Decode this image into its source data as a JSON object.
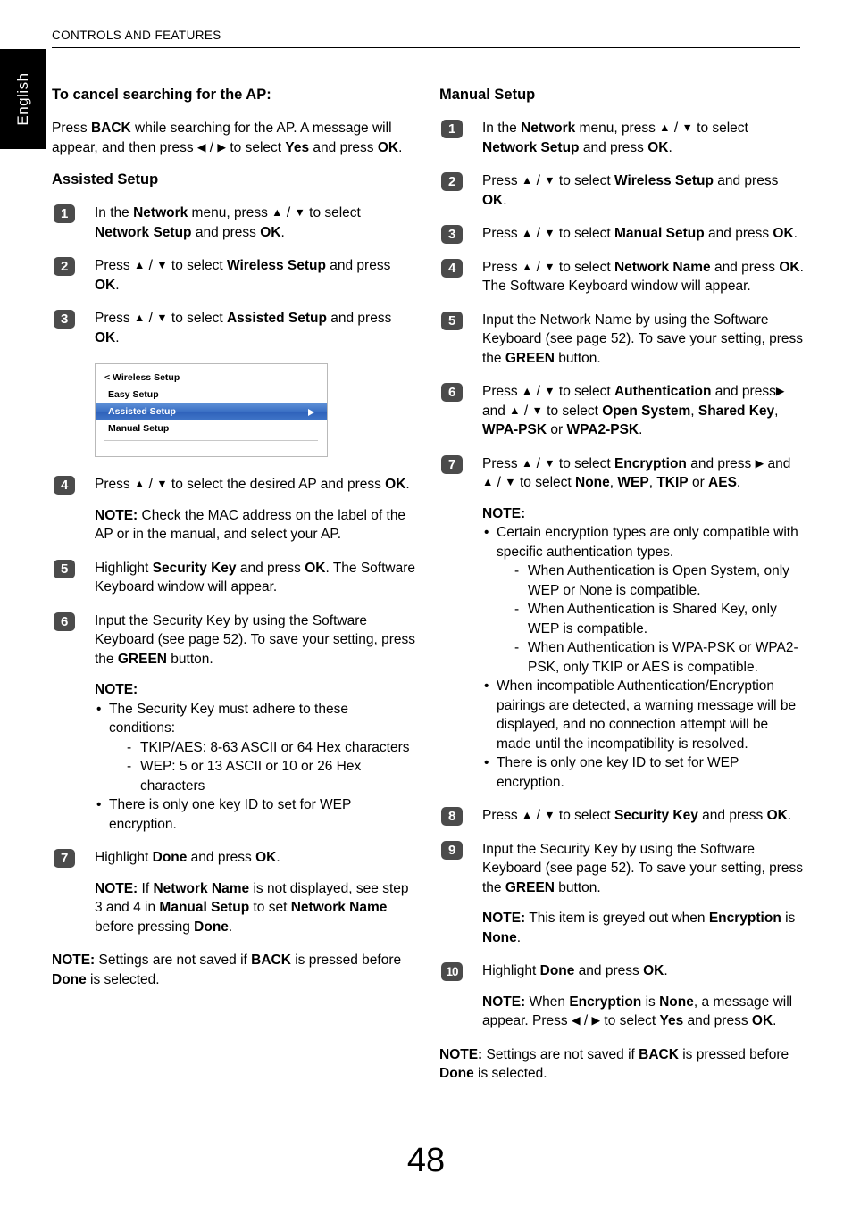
{
  "header": {
    "title": "CONTROLS AND FEATURES"
  },
  "language_tab": {
    "label": "English"
  },
  "page_number": "48",
  "left_column": {
    "cancel_heading": "To cancel searching for the AP:",
    "cancel_paragraph_parts": {
      "a": "Press ",
      "b1": "BACK",
      "c": " while searching for the AP. A message will appear, and then press ",
      "arrow_left": "◀",
      "slash": " / ",
      "arrow_right": "▶",
      "d": " to select ",
      "b2": "Yes",
      "e": " and press ",
      "b3": "OK",
      "f": "."
    },
    "assisted_heading": "Assisted Setup",
    "steps": {
      "s1": {
        "badge": "1",
        "t1": "In the ",
        "b1": "Network",
        "t2": " menu, press ",
        "up": "▲",
        "slash": " / ",
        "down": "▼",
        "t3": " to select ",
        "b2": "Network Setup",
        "t4": " and press ",
        "b3": "OK",
        "t5": "."
      },
      "s2": {
        "badge": "2",
        "t1": "Press ",
        "up": "▲",
        "slash": " / ",
        "down": "▼",
        "t2": " to select ",
        "b1": "Wireless Setup",
        "t3": " and press ",
        "b2": "OK",
        "t4": "."
      },
      "s3": {
        "badge": "3",
        "t1": "Press ",
        "up": "▲",
        "slash": " / ",
        "down": "▼",
        "t2": " to select ",
        "b1": "Assisted Setup",
        "t3": " and press ",
        "b2": "OK",
        "t4": "."
      },
      "s4": {
        "badge": "4",
        "t1": "Press ",
        "up": "▲",
        "slash": " / ",
        "down": "▼",
        "t2": " to select the desired AP and press ",
        "b1": "OK",
        "t3": ".",
        "note_label": "NOTE:",
        "note_text": " Check the MAC address on the label of the AP or in the manual, and select your AP."
      },
      "s5": {
        "badge": "5",
        "t1": "Highlight ",
        "b1": "Security Key",
        "t2": " and press ",
        "b2": "OK",
        "t3": ". The Software Keyboard window will appear."
      },
      "s6": {
        "badge": "6",
        "t1": "Input the Security Key by using the Software Keyboard (see page 52). To save your setting, press the ",
        "b1": "GREEN",
        "t2": " button.",
        "note_label": "NOTE:",
        "bullet1": "The Security Key must adhere to these conditions:",
        "sub1": "TKIP/AES: 8-63 ASCII or 64 Hex characters",
        "sub2": "WEP: 5 or 13 ASCII or 10 or 26 Hex characters",
        "bullet2": "There is only one key ID to set for WEP encryption."
      },
      "s7": {
        "badge": "7",
        "t1": "Highlight ",
        "b1": "Done",
        "t2": " and press ",
        "b2": "OK",
        "t3": ".",
        "note_label": "NOTE:",
        "n1": " If ",
        "nb1": "Network Name",
        "n2": " is not displayed, see step 3 and 4 in ",
        "nb2": "Manual Setup",
        "n3": " to set ",
        "nb3": "Network Name",
        "n4": " before pressing ",
        "nb4": "Done",
        "n5": "."
      }
    },
    "final_note": {
      "label": "NOTE:",
      "t1": " Settings are not saved if ",
      "b1": "BACK",
      "t2": " is pressed before ",
      "b2": "Done",
      "t3": " is selected."
    },
    "osd_menu": {
      "title": "< Wireless Setup",
      "items": [
        {
          "label": "Easy Setup",
          "selected": false
        },
        {
          "label": "Assisted Setup",
          "selected": true
        },
        {
          "label": "Manual Setup",
          "selected": false
        }
      ],
      "highlight_color": "#3a6fc4",
      "arrow_icon": "right-triangle"
    }
  },
  "right_column": {
    "manual_heading": "Manual Setup",
    "steps": {
      "s1": {
        "badge": "1",
        "t1": "In the ",
        "b1": "Network",
        "t2": " menu, press ",
        "up": "▲",
        "slash": " / ",
        "down": "▼",
        "t3": " to select ",
        "b2": "Network Setup",
        "t4": " and press ",
        "b3": "OK",
        "t5": "."
      },
      "s2": {
        "badge": "2",
        "t1": "Press ",
        "up": "▲",
        "slash": " / ",
        "down": "▼",
        "t2": " to select ",
        "b1": "Wireless Setup",
        "t3": " and press ",
        "b2": "OK",
        "t4": "."
      },
      "s3": {
        "badge": "3",
        "t1": "Press ",
        "up": "▲",
        "slash": " / ",
        "down": "▼",
        "t2": " to select ",
        "b1": "Manual Setup",
        "t3": " and press ",
        "b2": "OK",
        "t4": "."
      },
      "s4": {
        "badge": "4",
        "t1": "Press ",
        "up": "▲",
        "slash": " / ",
        "down": "▼",
        "t2": " to select ",
        "b1": "Network Name",
        "t3": " and press ",
        "b2": "OK",
        "t4": ". The Software Keyboard window will appear."
      },
      "s5": {
        "badge": "5",
        "t1": "Input the Network Name by using the Software Keyboard (see page 52). To save your setting, press the ",
        "b1": "GREEN",
        "t2": " button."
      },
      "s6": {
        "badge": "6",
        "t1": "Press ",
        "up": "▲",
        "slash": " / ",
        "down": "▼",
        "t2": " to select ",
        "b1": "Authentication",
        "t3": " and press",
        "right": "▶",
        "t4": " and ",
        "up2": "▲",
        "slash2": " / ",
        "down2": "▼",
        "t5": " to select ",
        "b2": "Open System",
        "t6": ", ",
        "b3": "Shared Key",
        "t7": ", ",
        "b4": "WPA-PSK",
        "t8": " or ",
        "b5": "WPA2-PSK",
        "t9": "."
      },
      "s7": {
        "badge": "7",
        "t1": "Press ",
        "up": "▲",
        "slash": " / ",
        "down": "▼",
        "t2": " to select ",
        "b1": "Encryption",
        "t3": " and press ",
        "right": "▶",
        "t4": " and ",
        "up2": "▲",
        "slash2": " / ",
        "down2": "▼",
        "t5": " to select ",
        "b2": "None",
        "t6": ", ",
        "b3": "WEP",
        "t7": ", ",
        "b4": "TKIP",
        "t8": " or ",
        "b5": "AES",
        "t9": ".",
        "note_label": "NOTE:",
        "bullet1": "Certain encryption types are only compatible with specific authentication types.",
        "sub1": "When Authentication is Open System, only WEP or None is compatible.",
        "sub2": "When Authentication is Shared Key, only WEP is compatible.",
        "sub3": "When Authentication is WPA-PSK or WPA2-PSK, only TKIP or AES is compatible.",
        "bullet2": "When incompatible Authentication/Encryption pairings are detected, a warning message will be displayed, and no connection attempt will be made until the incompatibility is resolved.",
        "bullet3": "There is only one key ID to set for WEP encryption."
      },
      "s8": {
        "badge": "8",
        "t1": "Press ",
        "up": "▲",
        "slash": " / ",
        "down": "▼",
        "t2": " to select ",
        "b1": "Security Key",
        "t3": " and press ",
        "b2": "OK",
        "t4": "."
      },
      "s9": {
        "badge": "9",
        "t1": "Input the Security Key by using the Software Keyboard (see page 52). To save your setting, press the ",
        "b1": "GREEN",
        "t2": " button.",
        "note_label": "NOTE:",
        "n1": " This item is greyed out when ",
        "nb1": "Encryption",
        "n2": " is ",
        "nb2": "None",
        "n3": "."
      },
      "s10": {
        "badge": "10",
        "t1": "Highlight ",
        "b1": "Done",
        "t2": " and press ",
        "b2": "OK",
        "t3": ".",
        "note_label": "NOTE:",
        "n1": " When ",
        "nb1": "Encryption",
        "n2": " is ",
        "nb2": "None",
        "n3": ", a message will appear. Press ",
        "arrow_left": "◀",
        "slash": " / ",
        "arrow_right": "▶",
        "n4": " to select ",
        "nb3": "Yes",
        "n5": " and press ",
        "nb4": "OK",
        "n6": "."
      }
    },
    "final_note": {
      "label": "NOTE:",
      "t1": " Settings are not saved if ",
      "b1": "BACK",
      "t2": " is pressed before ",
      "b2": "Done",
      "t3": " is selected."
    }
  }
}
